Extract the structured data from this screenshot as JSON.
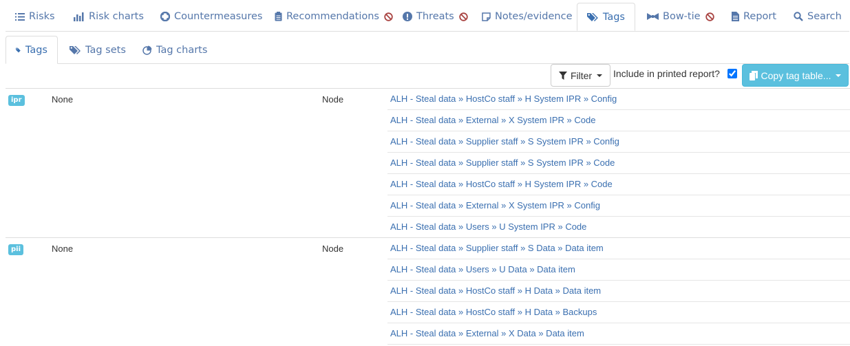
{
  "nav": {
    "tabs": [
      {
        "label": "Risks",
        "icon": "list-icon",
        "disabled": false
      },
      {
        "label": "Risk charts",
        "icon": "bar-chart-icon",
        "disabled": false
      },
      {
        "label": "Countermeasures",
        "icon": "life-ring-icon",
        "disabled": false
      },
      {
        "label": "Recommendations",
        "icon": "clipboard-icon",
        "disabled": true
      },
      {
        "label": "Threats",
        "icon": "exclamation-circle-icon",
        "disabled": true
      },
      {
        "label": "Notes/evidence",
        "icon": "note-icon",
        "disabled": false
      },
      {
        "label": "Tags",
        "icon": "tags-icon",
        "disabled": false,
        "active": true
      },
      {
        "label": "Bow-tie",
        "icon": "bow-tie-icon",
        "disabled": true
      },
      {
        "label": "Report",
        "icon": "file-icon",
        "disabled": false
      },
      {
        "label": "Search",
        "icon": "search-icon",
        "disabled": false
      }
    ]
  },
  "subnav": {
    "tabs": [
      {
        "label": "Tags",
        "icon": "tag-icon",
        "active": true
      },
      {
        "label": "Tag sets",
        "icon": "tags-icon"
      },
      {
        "label": "Tag charts",
        "icon": "pie-chart-icon"
      }
    ]
  },
  "toolbar": {
    "filter_label": "Filter",
    "include_label": "Include in printed report?",
    "include_checked": true,
    "copy_label": "Copy tag table..."
  },
  "tags": [
    {
      "badge": "ipr",
      "value": "None",
      "type": "Node",
      "paths": [
        "ALH - Steal data » HostCo staff » H System IPR » Config",
        "ALH - Steal data » External » X System IPR » Code",
        "ALH - Steal data » Supplier staff » S System IPR » Config",
        "ALH - Steal data » Supplier staff » S System IPR » Code",
        "ALH - Steal data » HostCo staff » H System IPR » Code",
        "ALH - Steal data » External » X System IPR » Config",
        "ALH - Steal data » Users » U System IPR » Code"
      ]
    },
    {
      "badge": "pii",
      "value": "None",
      "type": "Node",
      "paths": [
        "ALH - Steal data » Supplier staff » S Data » Data item",
        "ALH - Steal data » Users » U Data » Data item",
        "ALH - Steal data » HostCo staff » H Data » Data item",
        "ALH - Steal data » HostCo staff » H Data » Backups",
        "ALH - Steal data » External » X Data » Data item"
      ]
    }
  ],
  "colors": {
    "link": "#3a6fb0",
    "nav_text": "#5577aa",
    "badge": "#5bc0de",
    "disabled_marker": "#a94442",
    "copy_button": "#5bc0de"
  }
}
